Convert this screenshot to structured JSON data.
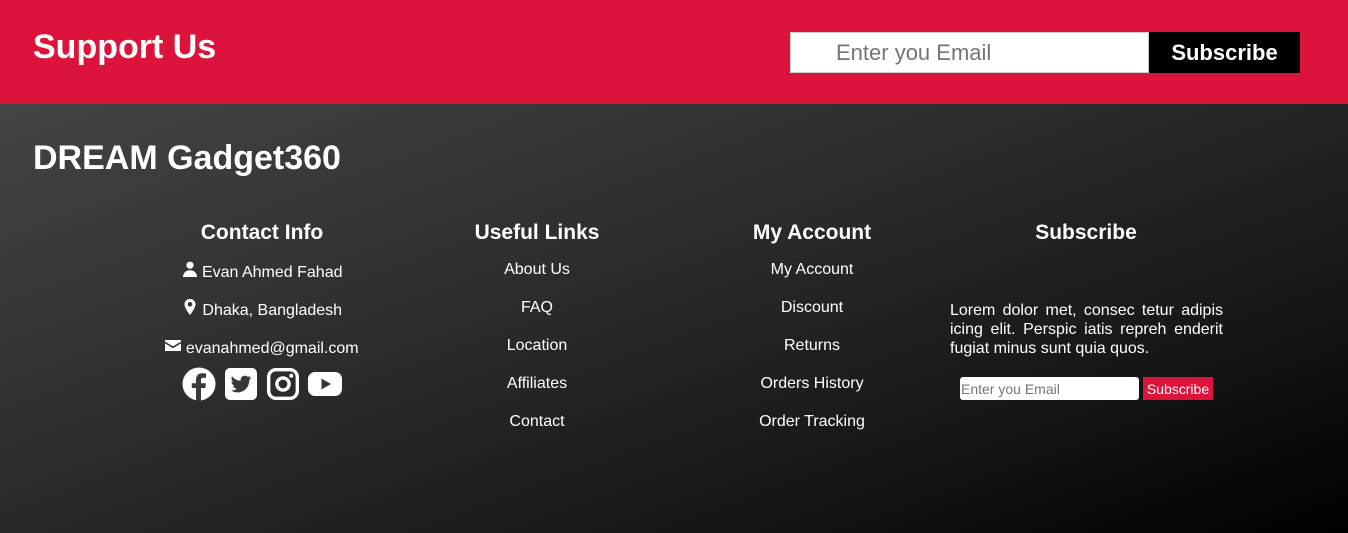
{
  "support": {
    "title": "Support Us",
    "email_placeholder": "Enter you Email",
    "subscribe_label": "Subscribe"
  },
  "footer": {
    "brand": "DREAM Gadget360",
    "contact": {
      "heading": "Contact Info",
      "name": "Evan Ahmed Fahad",
      "location": "Dhaka, Bangladesh",
      "email": "evanahmed@gmail.com",
      "socials": [
        "facebook-icon",
        "twitter-icon",
        "instagram-icon",
        "youtube-icon"
      ]
    },
    "useful_links": {
      "heading": "Useful Links",
      "items": [
        "About Us",
        "FAQ",
        "Location",
        "Affiliates",
        "Contact"
      ]
    },
    "my_account": {
      "heading": "My Account",
      "items": [
        "My Account",
        "Discount",
        "Returns",
        "Orders History",
        "Order Tracking"
      ]
    },
    "subscribe": {
      "heading": "Subscribe",
      "text": "Lorem dolor met, consec tetur adipis icing elit. Perspic iatis repreh enderit fugiat minus sunt quia quos.",
      "email_placeholder": "Enter you Email",
      "button_label": "Subscribe"
    }
  },
  "colors": {
    "accent": "#dc143c",
    "dark": "#000000"
  }
}
